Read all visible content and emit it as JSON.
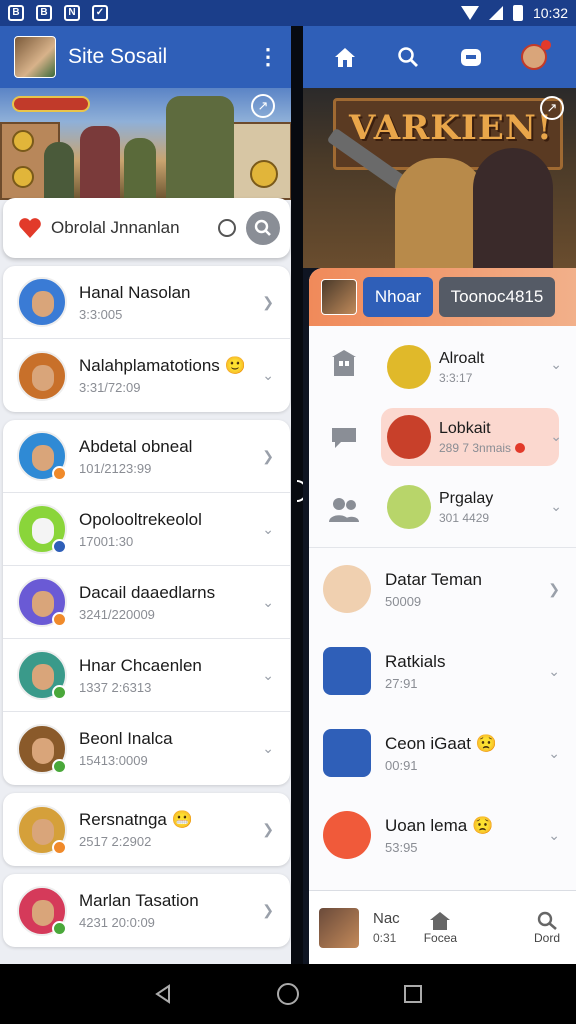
{
  "status_bar": {
    "time": "10:32",
    "left_icons": [
      "B",
      "B",
      "N",
      "✓"
    ]
  },
  "left_app": {
    "title": "Site Sosail",
    "search": {
      "text": "Obrolal Jnnanlan"
    },
    "contacts": [
      {
        "name": "Hanal Nasolan",
        "sub": "3:3:005",
        "status_color": "",
        "avatar_bg": "#3a7bd5",
        "emoji": ""
      },
      {
        "name": "Nalahplamatotions",
        "sub": "3:31/72:09",
        "status_color": "",
        "avatar_bg": "#c8702a",
        "emoji": "🙂"
      },
      {
        "name": "Abdetal obneal",
        "sub": "101/2123:99",
        "status_color": "#f08a2a",
        "avatar_bg": "#2f8ad5",
        "emoji": ""
      },
      {
        "name": "Opolooltrekeolol",
        "sub": "17001:30",
        "status_color": "#2f5fb8",
        "avatar_bg": "#8ad53a",
        "emoji": ""
      },
      {
        "name": "Dacail daaedlarns",
        "sub": "3241/220009",
        "status_color": "#f08a2a",
        "avatar_bg": "#6a5ad5",
        "emoji": ""
      },
      {
        "name": "Hnar Chcaenlen",
        "sub": "1337 2:6313",
        "status_color": "#4aa83a",
        "avatar_bg": "#3a9a8a",
        "emoji": ""
      },
      {
        "name": "Beonl Inalca",
        "sub": "15413:0009",
        "status_color": "#4aa83a",
        "avatar_bg": "#8a5a2a",
        "emoji": ""
      },
      {
        "name": "Rersnatnga",
        "sub": "2517 2:2902",
        "status_color": "#f08a2a",
        "avatar_bg": "#d5a03a",
        "emoji": "😬"
      },
      {
        "name": "Marlan Tasation",
        "sub": "4231 20:0:09",
        "status_color": "#4aa83a",
        "avatar_bg": "#d53a5a",
        "emoji": ""
      }
    ]
  },
  "right_app": {
    "banner_title": "VARKIEN!",
    "tabs": [
      "Nhoar",
      "Toonoc4815"
    ],
    "groups": [
      {
        "name": "Alroalt",
        "sub": "3:3:17",
        "avatar_bg": "#e0b92a",
        "active": false,
        "red_dot": false
      },
      {
        "name": "Lobkait",
        "sub": "289 7 3nmais",
        "avatar_bg": "#c8402a",
        "active": true,
        "red_dot": true
      },
      {
        "name": "Prgalay",
        "sub": "301 4429",
        "avatar_bg": "#b8d56a",
        "active": false,
        "red_dot": false
      }
    ],
    "rows": [
      {
        "name": "Datar Teman",
        "sub": "50009",
        "avatar_bg": "#f0d0b0",
        "square": false,
        "emoji": "",
        "status_color": "#f08a2a"
      },
      {
        "name": "Ratkials",
        "sub": "27:91",
        "avatar_bg": "#2f5fb8",
        "square": true,
        "emoji": "",
        "status_color": ""
      },
      {
        "name": "Ceon iGaat",
        "sub": "00:91",
        "avatar_bg": "#2f5fb8",
        "square": true,
        "emoji": "😟",
        "status_color": ""
      },
      {
        "name": "Uoan lema",
        "sub": "53:95",
        "avatar_bg": "#f05a3a",
        "square": false,
        "emoji": "😟",
        "status_color": "#6a5ad5"
      }
    ],
    "bottom": {
      "name": "Nac",
      "sub": "0:31",
      "nav": [
        "Focea",
        "Dord"
      ]
    }
  },
  "colors": {
    "header_blue": "#2f5fb8",
    "status_bar": "#1b3e8a",
    "accent_red": "#e23a2a"
  }
}
